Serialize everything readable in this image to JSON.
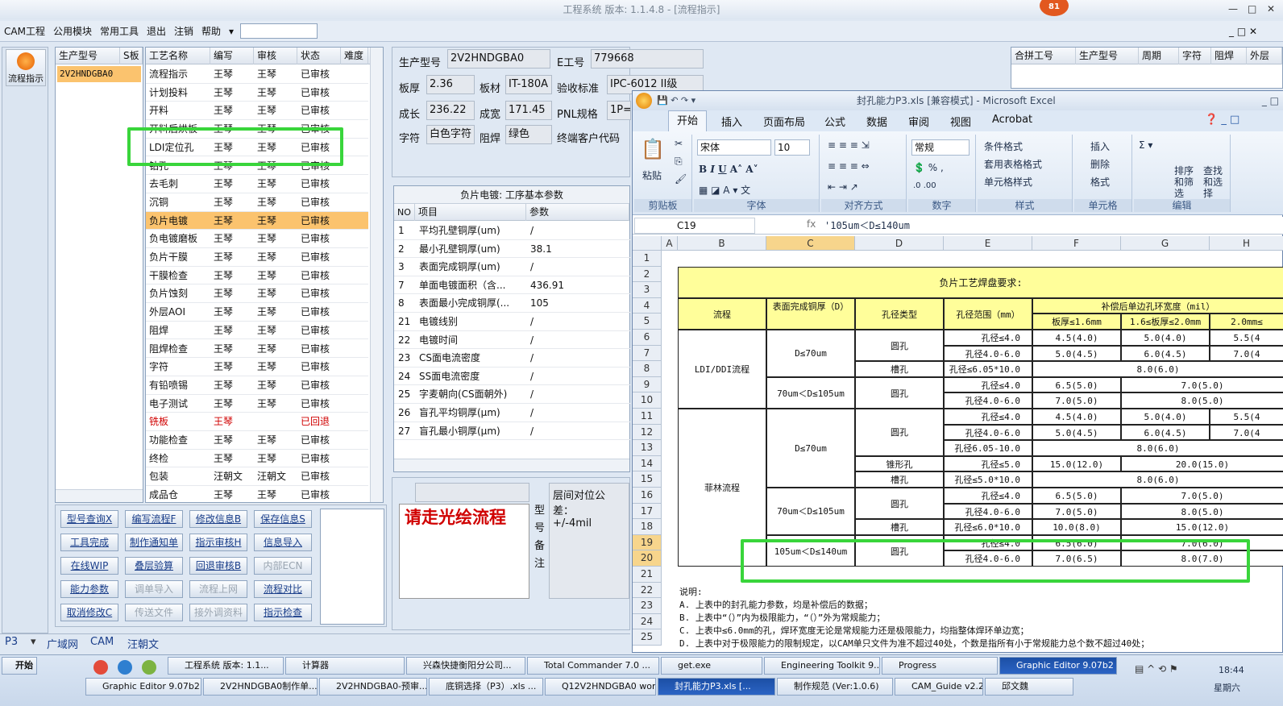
{
  "window": {
    "title": "工程系统  版本: 1.1.4.8 - [流程指示]",
    "badge": "81",
    "ctl_min": "—",
    "ctl_max": "□",
    "ctl_close": "✕"
  },
  "menu": [
    "CAM工程",
    "公用模块",
    "常用工具",
    "退出",
    "注销",
    "帮助"
  ],
  "nav": {
    "flow_label": "流程指示"
  },
  "model_list": {
    "headers": [
      "生产型号",
      "S板"
    ],
    "items": [
      "2V2HNDGBA0"
    ]
  },
  "process_list": {
    "headers": [
      "工艺名称",
      "编写",
      "审核",
      "状态",
      "难度"
    ],
    "rows": [
      [
        "流程指示",
        "王琴",
        "王琴",
        "已审核"
      ],
      [
        "计划投料",
        "王琴",
        "王琴",
        "已审核"
      ],
      [
        "开料",
        "王琴",
        "王琴",
        "已审核"
      ],
      [
        "开料后烘板",
        "王琴",
        "王琴",
        "已审核"
      ],
      [
        "LDI定位孔",
        "王琴",
        "王琴",
        "已审核"
      ],
      [
        "钻孔",
        "王琴",
        "王琴",
        "已审核"
      ],
      [
        "去毛刺",
        "王琴",
        "王琴",
        "已审核"
      ],
      [
        "沉铜",
        "王琴",
        "王琴",
        "已审核"
      ],
      [
        "负片电镀",
        "王琴",
        "王琴",
        "已审核"
      ],
      [
        "负电镀磨板",
        "王琴",
        "王琴",
        "已审核"
      ],
      [
        "负片干膜",
        "王琴",
        "王琴",
        "已审核"
      ],
      [
        "干膜检查",
        "王琴",
        "王琴",
        "已审核"
      ],
      [
        "负片蚀刻",
        "王琴",
        "王琴",
        "已审核"
      ],
      [
        "外层AOI",
        "王琴",
        "王琴",
        "已审核"
      ],
      [
        "阻焊",
        "王琴",
        "王琴",
        "已审核"
      ],
      [
        "阻焊检查",
        "王琴",
        "王琴",
        "已审核"
      ],
      [
        "字符",
        "王琴",
        "王琴",
        "已审核"
      ],
      [
        "有铅喷锡",
        "王琴",
        "王琴",
        "已审核"
      ],
      [
        "电子测试",
        "王琴",
        "王琴",
        "已审核"
      ],
      [
        "铣板",
        "王琴",
        "",
        "已回退"
      ],
      [
        "功能检查",
        "王琴",
        "王琴",
        "已审核"
      ],
      [
        "终检",
        "王琴",
        "王琴",
        "已审核"
      ],
      [
        "包装",
        "汪朝文",
        "汪朝文",
        "已审核"
      ],
      [
        "成品仓",
        "王琴",
        "王琴",
        "已审核"
      ]
    ]
  },
  "buttons": [
    [
      "型号查询X",
      "编写流程F",
      "修改信息B",
      "保存信息S"
    ],
    [
      "工具完成",
      "制作通知单",
      "指示审核H",
      "信息导入"
    ],
    [
      "在线WIP",
      "叠层验算",
      "回退审核B",
      "内部ECN"
    ],
    [
      "能力参数",
      "调单导入",
      "流程上网",
      "流程对比"
    ],
    [
      "取消修改C",
      "传送文件",
      "接外调资料",
      "指示检查"
    ]
  ],
  "info": {
    "model_label": "生产型号",
    "model": "2V2HNDGBA0",
    "e_label": "E工号",
    "e_no": "779668",
    "thick_label": "板厚",
    "thick": "2.36",
    "material_label": "板材",
    "material": "IT-180A",
    "std_label": "验收标准",
    "std": "IPC-6012 II级",
    "len_label": "成长",
    "len": "236.22",
    "wid_label": "成宽",
    "wid": "171.45",
    "pnl_label": "PNL规格",
    "pnl": "1P=",
    "char_label": "字符",
    "char": "白色字符",
    "mask_label": "阻焊",
    "mask": "绿色",
    "cust_label": "终端客户代码"
  },
  "param_grid": {
    "title": "负片电镀: 工序基本参数",
    "headers": [
      "NO",
      "项目",
      "参数"
    ],
    "rows": [
      [
        "1",
        "平均孔壁铜厚(um)",
        "/"
      ],
      [
        "2",
        "最小孔壁铜厚(um)",
        "38.1"
      ],
      [
        "3",
        "表面完成铜厚(um)",
        "/"
      ],
      [
        "7",
        "单面电镀面积（含...",
        "436.91"
      ],
      [
        "8",
        "表面最小完成铜厚(...",
        "105"
      ],
      [
        "21",
        "电镀线别",
        "/"
      ],
      [
        "22",
        "电镀时间",
        "/"
      ],
      [
        "23",
        "CS面电流密度",
        "/"
      ],
      [
        "24",
        "SS面电流密度",
        "/"
      ],
      [
        "25",
        "字麦朝向(CS面朝外)",
        "/"
      ],
      [
        "26",
        "盲孔平均铜厚(μm)",
        "/"
      ],
      [
        "27",
        "盲孔最小铜厚(μm)",
        "/"
      ]
    ]
  },
  "notes": {
    "red_note": "请走光绘流程",
    "side_label": "型号备注",
    "tolerance_label": "层间对位公差：",
    "tolerance": "+/-4mil"
  },
  "right_table": {
    "headers": [
      "合拼工号",
      "生产型号",
      "周期",
      "字符",
      "阻焊",
      "外层"
    ]
  },
  "status": {
    "p3": "P3",
    "lan": "广域网",
    "cam": "CAM",
    "user": "汪朝文"
  },
  "excel": {
    "title": "封孔能力P3.xls [兼容模式] - Microsoft Excel",
    "tabs": [
      "开始",
      "插入",
      "页面布局",
      "公式",
      "数据",
      "审阅",
      "视图",
      "Acrobat"
    ],
    "groups": [
      "剪贴板",
      "字体",
      "对齐方式",
      "数字",
      "样式",
      "单元格",
      "编辑"
    ],
    "paste": "粘贴",
    "font": "宋体",
    "size": "10",
    "numfmt": "常规",
    "style_btns": [
      "条件格式",
      "套用表格格式",
      "单元格样式"
    ],
    "cell_btns": [
      "插入",
      "删除",
      "格式"
    ],
    "edit_btns": [
      "排序和筛选",
      "查找和选择"
    ],
    "namebox": "C19",
    "formula": "'105um＜D≤140um",
    "cols": [
      "A",
      "B",
      "C",
      "D",
      "E",
      "F",
      "G",
      "H"
    ],
    "heading": "负片工艺焊盘要求:",
    "h_flow": "流程",
    "h_cu": "表面完成铜厚（D）",
    "h_type": "孔径类型",
    "h_range": "孔径范围（mm）",
    "h_ring": "补偿后单边孔环宽度（mil）",
    "h_t1": "板厚≤1.6mm",
    "h_t2": "1.6≤板厚≤2.0mm",
    "h_t3": "2.0mm≤",
    "g_ldi": "LDI/DDI流程",
    "g_film": "菲林流程",
    "d70": "D≤70um",
    "d105": "70um＜D≤105um",
    "d140": "105um＜D≤140um",
    "round": "圆孔",
    "slot": "槽孔",
    "cone": "锥形孔",
    "cells": {
      "r6": [
        "孔径≤4.0",
        "4.5(4.0)",
        "5.0(4.0)",
        "5.5(4"
      ],
      "r7": [
        "孔径4.0-6.0",
        "5.0(4.5)",
        "6.0(4.5)",
        "7.0(4"
      ],
      "r8": [
        "孔径≤6.05*10.0",
        "8.0(6.0)"
      ],
      "r9": [
        "孔径≤4.0",
        "6.5(5.0)",
        "7.0(5.0)"
      ],
      "r10": [
        "孔径4.0-6.0",
        "7.0(5.0)",
        "8.0(5.0)"
      ],
      "r11": [
        "孔径≤4.0",
        "4.5(4.0)",
        "5.0(4.0)",
        "5.5(4"
      ],
      "r12": [
        "孔径4.0-6.0",
        "5.0(4.5)",
        "6.0(4.5)",
        "7.0(4"
      ],
      "r13": [
        "孔径6.05-10.0",
        "8.0(6.0)"
      ],
      "r14": [
        "孔径≤5.0",
        "15.0(12.0)",
        "20.0(15.0)"
      ],
      "r15": [
        "孔径≤5.0*10.0",
        "8.0(6.0)"
      ],
      "r16": [
        "孔径≤4.0",
        "6.5(5.0)",
        "7.0(5.0)"
      ],
      "r17": [
        "孔径4.0-6.0",
        "7.0(5.0)",
        "8.0(5.0)"
      ],
      "r18": [
        "孔径≤6.0*10.0",
        "10.0(8.0)",
        "15.0(12.0)"
      ],
      "r19": [
        "孔径≤4.0",
        "6.5(6.0)",
        "7.0(6.0)"
      ],
      "r20": [
        "孔径4.0-6.0",
        "7.0(6.5)",
        "8.0(7.0)"
      ]
    },
    "notes": [
      "说明:",
      "A. 上表中的封孔能力参数，均是补偿后的数据；",
      "B. 上表中“（）”内为极限能力，“（）”外为常规能力；",
      "C. 上表中≤6.0mm的孔，焊环宽度无论是常规能力还是极限能力，均指整体焊环单边宽；",
      "D. 上表中对于极限能力的限制规定，以CAM单只文件为准不超过40处，个数是指所有小于常规能力总个数不超过40处；"
    ]
  },
  "taskbar": {
    "start": "开始",
    "row1": [
      "工程系统 版本: 1.1...",
      "计算器",
      "兴森快捷衡阳分公司...",
      "Total Commander 7.0 ...",
      "get.exe",
      "Engineering Toolkit 9....",
      "Progress",
      "Graphic Editor 9.07b2 ..."
    ],
    "row2": [
      "Graphic Editor 9.07b2...",
      "2V2HNDGBA0制作单...",
      "2V2HNDGBA0-预审...",
      "底铜选择（P3）.xls ...",
      "Q12V2HNDGBA0 wor...",
      "封孔能力P3.xls [...",
      "制作规范 (Ver:1.0.6)",
      "CAM_Guide v2.23",
      "邱文魏"
    ],
    "time": "18:44",
    "day": "星期六"
  },
  "colors": {
    "highlight": "#39d53b",
    "selected_row": "#fbc36e",
    "red": "#d00000",
    "excel_header_fill": "#fffe9a"
  }
}
